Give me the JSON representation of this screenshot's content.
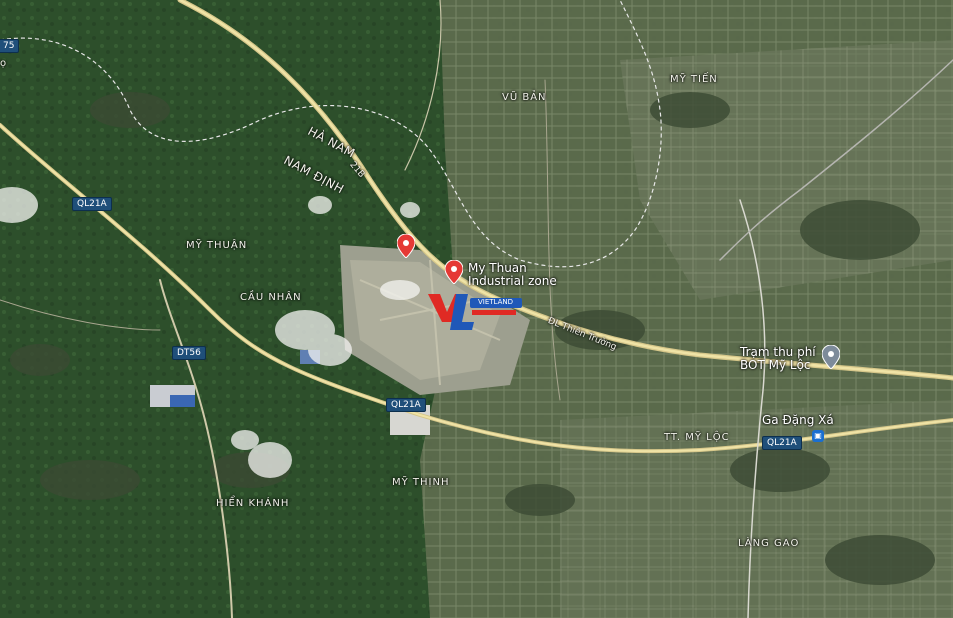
{
  "map": {
    "places": {
      "vu_ban": "VŨ BẢN",
      "my_tien": "MỸ TIẾN",
      "my_thuan": "MỸ THUẬN",
      "cau_nhan": "CẦU NHÂN",
      "my_thinh": "MỸ THỊNH",
      "hien_khanh": "HIỂN KHÁNH",
      "tt_my_loc": "TT. MỸ LỘC",
      "lang_gao": "LÀNG GAO"
    },
    "regions": {
      "ha_nam": "HÀ NAM",
      "nam_dinh": "NAM ĐỊNH"
    },
    "roads": {
      "ql21a": "QL21A",
      "dt56": "DT56",
      "r75": "75",
      "road_21b": "21B",
      "thien_truong": "ĐL Thiên Trường",
      "edge_char": "ọ"
    },
    "pois": {
      "industrial_zone": "My Thuan Industrial zone",
      "toll_station": "Trạm thu phí BOT Mỹ Lộc",
      "station": "Ga Đặng Xá"
    },
    "logo_text": "VIETLAND"
  },
  "colors": {
    "road_yellow": "#efe3a6",
    "shield_blue": "#1f4f7a",
    "pin_red": "#e53935",
    "poi_gray": "#7d8b9a",
    "logo_red": "#e02a24",
    "logo_blue": "#1f58b8"
  }
}
